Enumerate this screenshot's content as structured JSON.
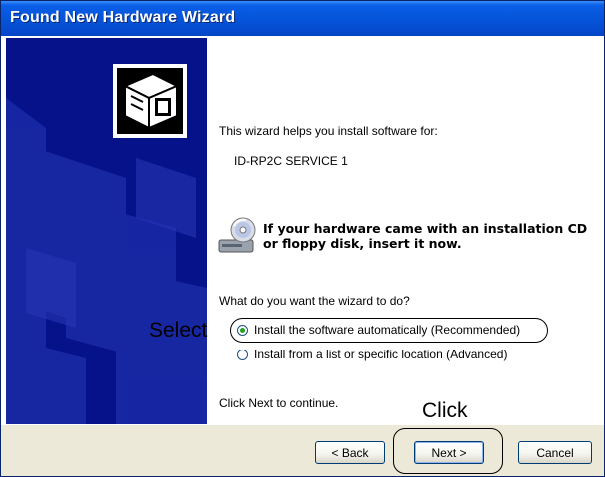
{
  "window": {
    "title": "Found New Hardware Wizard"
  },
  "sidebar": {
    "image_icon": "hardware-box-icon",
    "background_color": "#06128a"
  },
  "main": {
    "intro": "This wizard helps you install software for:",
    "device_name": "ID-RP2C SERVICE 1",
    "cd_notice": {
      "icon": "cd-drive-icon",
      "line1": "If your hardware came with an installation CD",
      "line2": "or floppy disk, insert it now."
    },
    "question": "What do you want the wizard to do?",
    "options": [
      {
        "label": "Install the software automatically (Recommended)",
        "selected": true
      },
      {
        "label": "Install from a list or specific location (Advanced)",
        "selected": false
      }
    ],
    "footer_text": "Click Next to continue."
  },
  "buttons": {
    "back": "< Back",
    "next": "Next >",
    "cancel": "Cancel"
  },
  "annotations": {
    "select": "Select",
    "click": "Click"
  }
}
